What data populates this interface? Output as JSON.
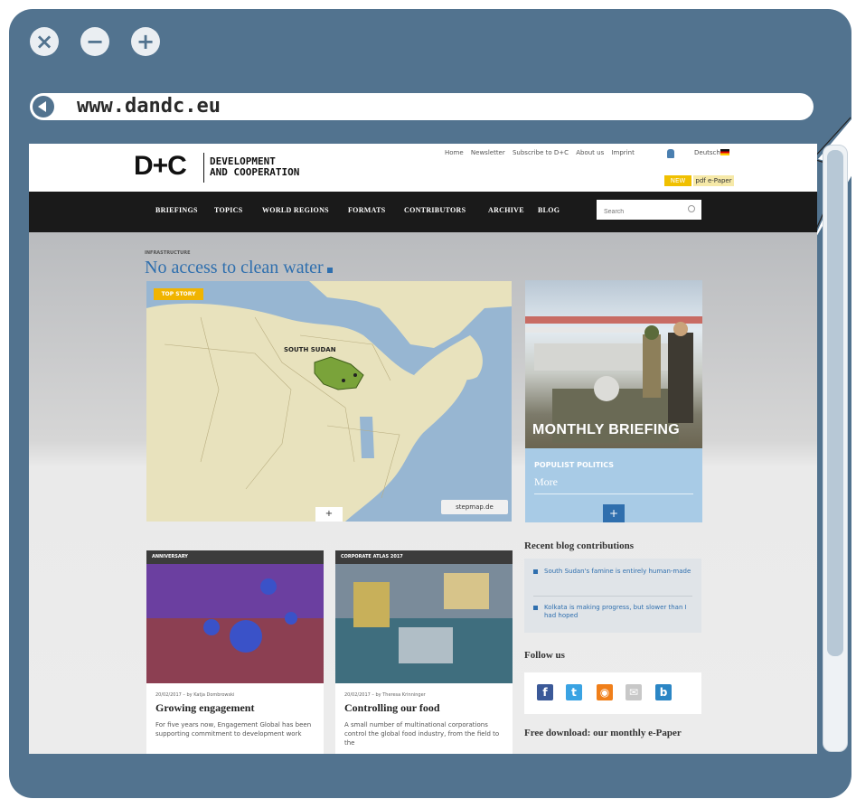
{
  "window": {
    "close_glyph": "×",
    "minimize_glyph": "−",
    "maximize_glyph": "+",
    "url": "www.dandc.eu"
  },
  "site": {
    "logo": "D+C",
    "logo_line1": "DEVELOPMENT",
    "logo_line2": "AND COOPERATION",
    "top_links": [
      "Home",
      "Newsletter",
      "Subscribe to D+C",
      "About us",
      "Imprint"
    ],
    "language": "Deutsch",
    "new_badge": "NEW",
    "epaper": "pdf e-Paper",
    "nav": [
      "BRIEFINGS",
      "TOPICS",
      "WORLD REGIONS",
      "FORMATS",
      "CONTRIBUTORS",
      "ARCHIVE",
      "BLOG"
    ],
    "search_placeholder": "Search"
  },
  "main": {
    "kicker": "INFRASTRUCTURE",
    "headline": "No access to clean water",
    "top_story_badge": "TOP STORY",
    "map_label": "SOUTH SUDAN",
    "map_credit": "stepmap.de",
    "map_button": "+"
  },
  "briefing": {
    "title": "MONTHLY BRIEFING",
    "subtitle": "POPULIST POLITICS",
    "more": "More",
    "plus": "+"
  },
  "cards": [
    {
      "category": "ANNIVERSARY",
      "meta": "20/02/2017 – by Katja Dombrowski",
      "title": "Growing engagement",
      "teaser": "For five years now, Engagement Global has been supporting commitment to development work"
    },
    {
      "category": "CORPORATE ATLAS 2017",
      "meta": "20/02/2017 – by Theresa Krinninger",
      "title": "Controlling our food",
      "teaser": "A small number of multinational corporations control the global food industry, from the field to the"
    }
  ],
  "sidebar": {
    "blog_heading": "Recent blog contributions",
    "blog_items": [
      "South Sudan's famine is entirely human-made",
      "Kolkata is making progress, but slower than I had hoped"
    ],
    "follow_heading": "Follow us",
    "social_icons": [
      {
        "name": "facebook-icon",
        "glyph": "f",
        "color": "#3b5998"
      },
      {
        "name": "twitter-icon",
        "glyph": "t",
        "color": "#3aa3e3"
      },
      {
        "name": "rss-icon",
        "glyph": "◉",
        "color": "#f07f1a"
      },
      {
        "name": "mail-icon",
        "glyph": "✉",
        "color": "#c8c8c8"
      },
      {
        "name": "blog-icon",
        "glyph": "b",
        "color": "#2b86c5"
      }
    ],
    "download_heading": "Free download: our monthly e-Paper"
  }
}
